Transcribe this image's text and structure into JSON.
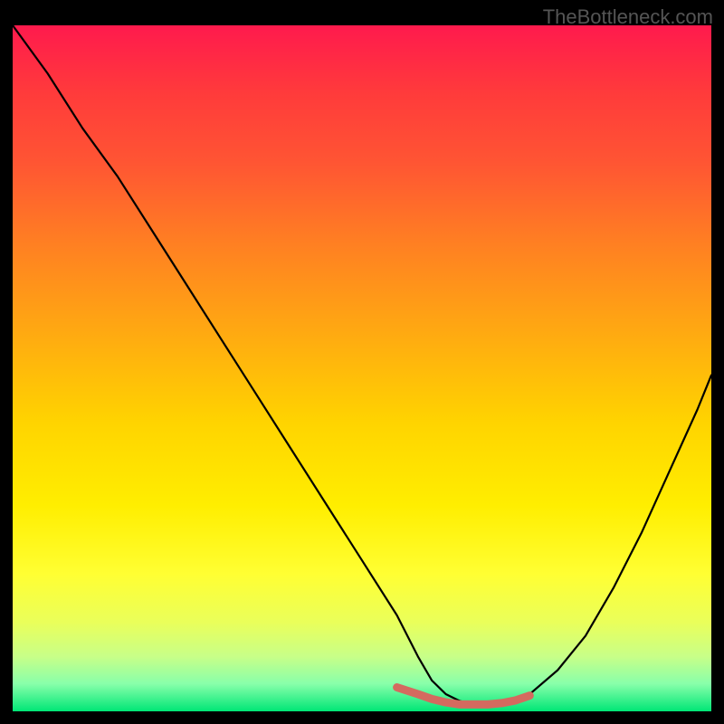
{
  "watermark": "TheBottleneck.com",
  "chart_data": {
    "type": "line",
    "title": "",
    "xlabel": "",
    "ylabel": "",
    "xlim": [
      0,
      100
    ],
    "ylim": [
      0,
      100
    ],
    "grid": false,
    "series": [
      {
        "name": "curve",
        "x": [
          0,
          5,
          10,
          15,
          20,
          25,
          30,
          35,
          40,
          45,
          50,
          55,
          58,
          60,
          62,
          64,
          66,
          68,
          70,
          72,
          74,
          78,
          82,
          86,
          90,
          94,
          98,
          100
        ],
        "values": [
          100,
          93,
          85,
          78,
          70,
          62,
          54,
          46,
          38,
          30,
          22,
          14,
          8,
          4.5,
          2.5,
          1.5,
          1.0,
          1.0,
          1.0,
          1.5,
          2.5,
          6.0,
          11,
          18,
          26,
          35,
          44,
          49
        ]
      },
      {
        "name": "highlight",
        "x": [
          55,
          58,
          60,
          62,
          64,
          66,
          68,
          70,
          72,
          74
        ],
        "values": [
          3.5,
          2.5,
          1.8,
          1.3,
          1.0,
          1.0,
          1.0,
          1.2,
          1.6,
          2.3
        ]
      }
    ],
    "colors": {
      "curve": "#000000",
      "highlight": "#d46a5f",
      "gradient_top": "#ff1a4d",
      "gradient_bottom": "#00e676"
    }
  }
}
